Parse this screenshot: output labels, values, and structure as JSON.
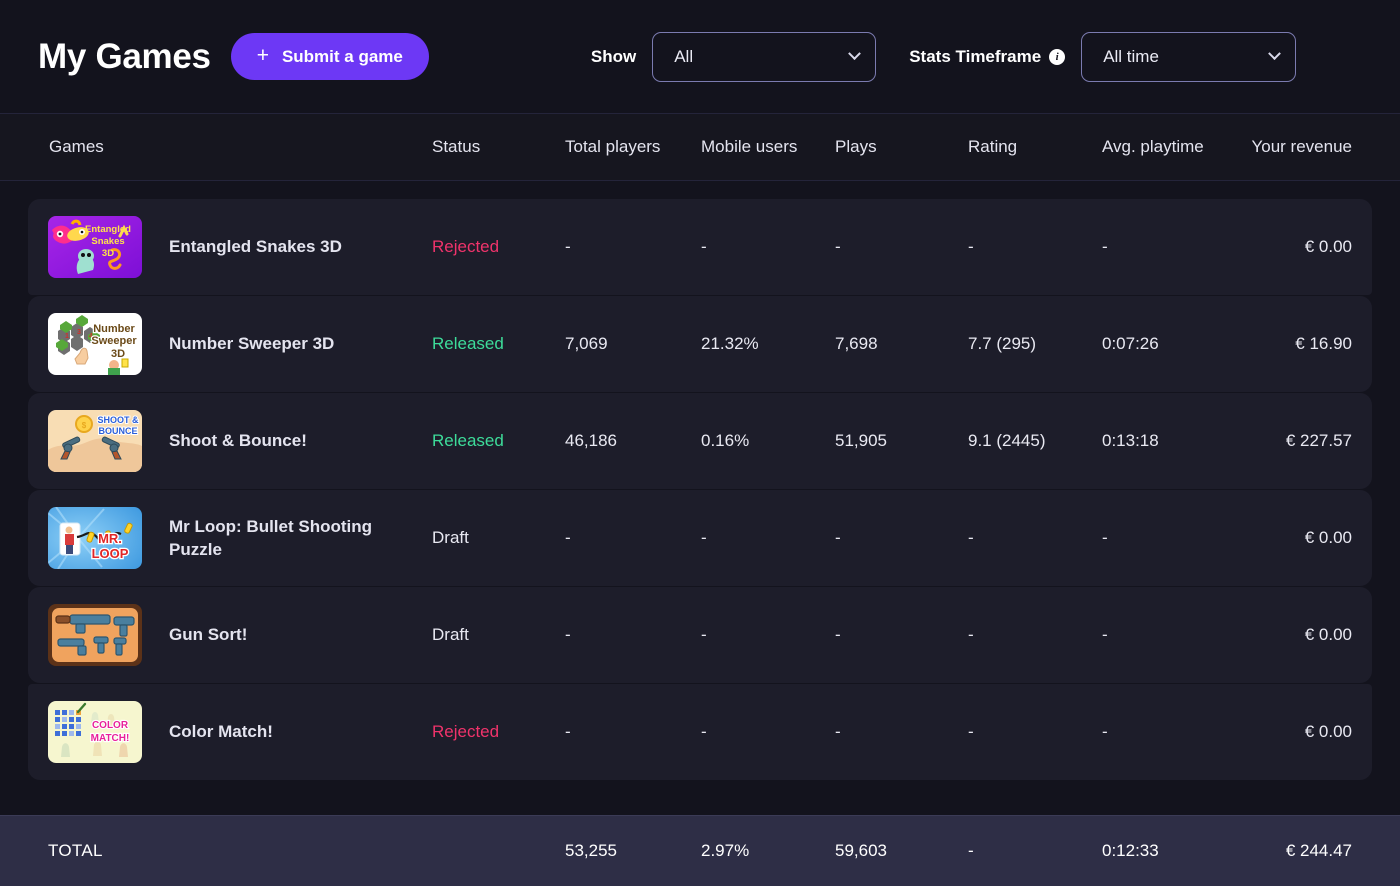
{
  "header": {
    "title": "My Games",
    "submit_label": "Submit a game",
    "plus_icon": "plus-icon",
    "show_label": "Show",
    "show_value": "All",
    "timeframe_label": "Stats Timeframe",
    "timeframe_value": "All time",
    "info_icon": "info-icon",
    "accent_color": "#6d38f5"
  },
  "table": {
    "columns": [
      "Games",
      "Status",
      "Total players",
      "Mobile users",
      "Plays",
      "Rating",
      "Avg. playtime",
      "Your revenue"
    ],
    "rows": [
      {
        "name": "Entangled Snakes 3D",
        "thumb": "entangled-snakes-3d-thumbnail",
        "status": "Rejected",
        "status_kind": "rejected",
        "total_players": "-",
        "mobile_users": "-",
        "plays": "-",
        "rating": "-",
        "avg_playtime": "-",
        "revenue": "€ 0.00"
      },
      {
        "name": "Number Sweeper 3D",
        "thumb": "number-sweeper-3d-thumbnail",
        "status": "Released",
        "status_kind": "released",
        "total_players": "7,069",
        "mobile_users": "21.32%",
        "plays": "7,698",
        "rating": "7.7 (295)",
        "avg_playtime": "0:07:26",
        "revenue": "€ 16.90"
      },
      {
        "name": "Shoot & Bounce!",
        "thumb": "shoot-and-bounce-thumbnail",
        "status": "Released",
        "status_kind": "released",
        "total_players": "46,186",
        "mobile_users": "0.16%",
        "plays": "51,905",
        "rating": "9.1 (2445)",
        "avg_playtime": "0:13:18",
        "revenue": "€ 227.57"
      },
      {
        "name": "Mr Loop: Bullet Shooting Puzzle",
        "thumb": "mr-loop-thumbnail",
        "status": "Draft",
        "status_kind": "draft",
        "total_players": "-",
        "mobile_users": "-",
        "plays": "-",
        "rating": "-",
        "avg_playtime": "-",
        "revenue": "€ 0.00"
      },
      {
        "name": "Gun Sort!",
        "thumb": "gun-sort-thumbnail",
        "status": "Draft",
        "status_kind": "draft",
        "total_players": "-",
        "mobile_users": "-",
        "plays": "-",
        "rating": "-",
        "avg_playtime": "-",
        "revenue": "€ 0.00"
      },
      {
        "name": "Color Match!",
        "thumb": "color-match-thumbnail",
        "status": "Rejected",
        "status_kind": "rejected",
        "total_players": "-",
        "mobile_users": "-",
        "plays": "-",
        "rating": "-",
        "avg_playtime": "-",
        "revenue": "€ 0.00"
      }
    ],
    "total": {
      "label": "TOTAL",
      "total_players": "53,255",
      "mobile_users": "2.97%",
      "plays": "59,603",
      "rating": "-",
      "avg_playtime": "0:12:33",
      "revenue": "€ 244.47"
    }
  },
  "status_colors": {
    "released": "#3ddc9a",
    "rejected": "#f0336b",
    "draft": "#e9e9f2"
  }
}
